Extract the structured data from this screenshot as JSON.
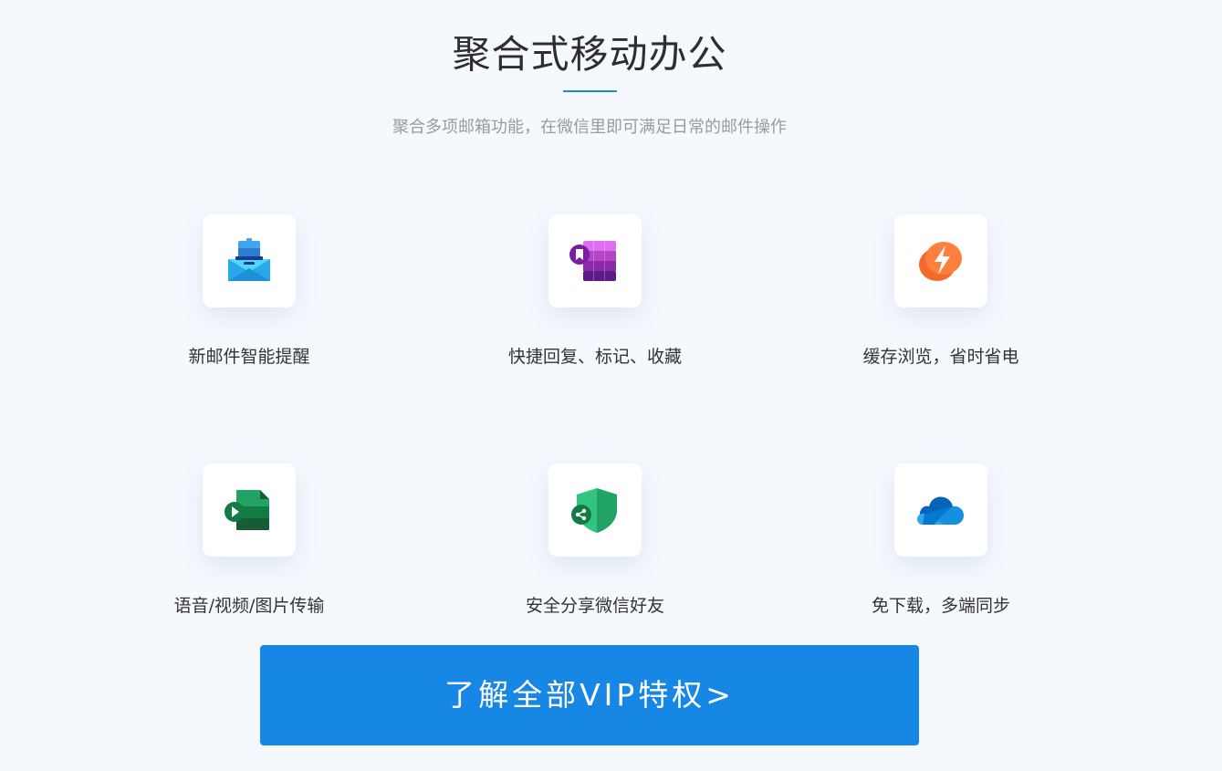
{
  "section": {
    "title": "聚合式移动办公",
    "subtitle": "聚合多项邮箱功能，在微信里即可满足日常的邮件操作"
  },
  "features": [
    {
      "label": "新邮件智能提醒",
      "icon": "mail-notify-icon"
    },
    {
      "label": "快捷回复、标记、收藏",
      "icon": "bookmark-grid-icon"
    },
    {
      "label": "缓存浏览，省时省电",
      "icon": "lightning-icon"
    },
    {
      "label": "语音/视频/图片传输",
      "icon": "media-play-icon"
    },
    {
      "label": "安全分享微信好友",
      "icon": "shield-share-icon"
    },
    {
      "label": "免下载，多端同步",
      "icon": "cloud-icon"
    }
  ],
  "cta": {
    "label": "了解全部VIP特权>"
  },
  "colors": {
    "accent": "#1787e6",
    "background": "#f5f9fe",
    "text": "#333333",
    "subtext": "#9a9a9a"
  }
}
